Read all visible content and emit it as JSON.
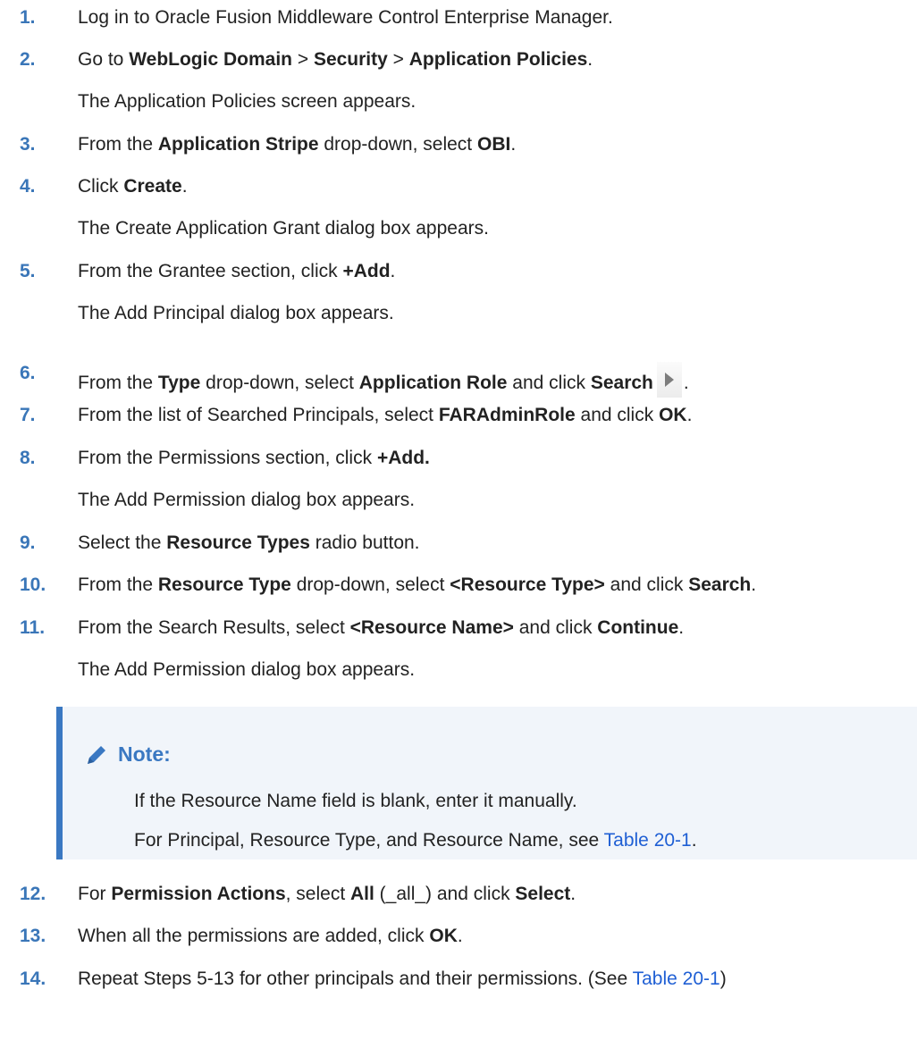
{
  "steps": [
    {
      "num": "1.",
      "parts": [
        "Log in to Oracle Fusion Middleware Control Enterprise Manager."
      ]
    },
    {
      "num": "2.",
      "parts": [
        "Go to ",
        "WebLogic Domain",
        " > ",
        "Security",
        " > ",
        "Application Policies",
        "."
      ],
      "sub": "The Application Policies screen appears."
    },
    {
      "num": "3.",
      "parts": [
        "From the ",
        "Application Stripe",
        " drop-down, select ",
        "OBI",
        "."
      ]
    },
    {
      "num": "4.",
      "parts": [
        "Click ",
        "Create",
        "."
      ],
      "sub": "The Create Application Grant dialog box appears."
    },
    {
      "num": "5.",
      "parts": [
        "From the Grantee section, click ",
        "+Add",
        "."
      ],
      "sub": "The Add Principal dialog box appears."
    },
    {
      "num": "6.",
      "parts": [
        "From the ",
        "Type",
        " drop-down, select ",
        "Application Role",
        " and click ",
        "Search",
        "."
      ]
    },
    {
      "num": "7.",
      "parts": [
        "From the list of Searched Principals, select ",
        "FARAdminRole",
        " and click ",
        "OK",
        "."
      ]
    },
    {
      "num": "8.",
      "parts": [
        "From the Permissions section, click ",
        "+Add."
      ],
      "sub": "The Add Permission dialog box appears."
    },
    {
      "num": "9.",
      "parts": [
        "Select the ",
        "Resource Types",
        " radio button."
      ]
    },
    {
      "num": "10.",
      "parts": [
        "From the ",
        "Resource Type",
        " drop-down, select ",
        "<Resource Type>",
        " and click ",
        "Search",
        "."
      ]
    },
    {
      "num": "11.",
      "parts": [
        "From the Search Results, select ",
        "<Resource Name>",
        " and click ",
        "Continue",
        "."
      ],
      "sub": "The Add Permission dialog box appears."
    },
    {
      "num": "12.",
      "parts": [
        "For ",
        "Permission Actions",
        ", select ",
        "All",
        " (_all_) and click ",
        "Select",
        "."
      ]
    },
    {
      "num": "13.",
      "parts": [
        "When all the permissions are added, click ",
        "OK",
        "."
      ]
    },
    {
      "num": "14.",
      "parts": [
        "Repeat Steps 5-13 for other principals and their permissions. (See ",
        "Table 20-1",
        ")"
      ]
    }
  ],
  "note": {
    "title": "Note:",
    "line1": "If the Resource Name field is blank, enter it manually.",
    "line2_prefix": "For Principal, Resource Type, and Resource Name, see ",
    "line2_link": "Table 20-1",
    "line2_suffix": "."
  },
  "colors": {
    "step_number": "#3a76b8",
    "link": "#1f5fd4",
    "note_accent": "#3a78c2",
    "note_background": "#f1f5fa"
  },
  "icons": {
    "note_icon": "pencil-icon",
    "search_icon": "play-triangle-icon"
  }
}
